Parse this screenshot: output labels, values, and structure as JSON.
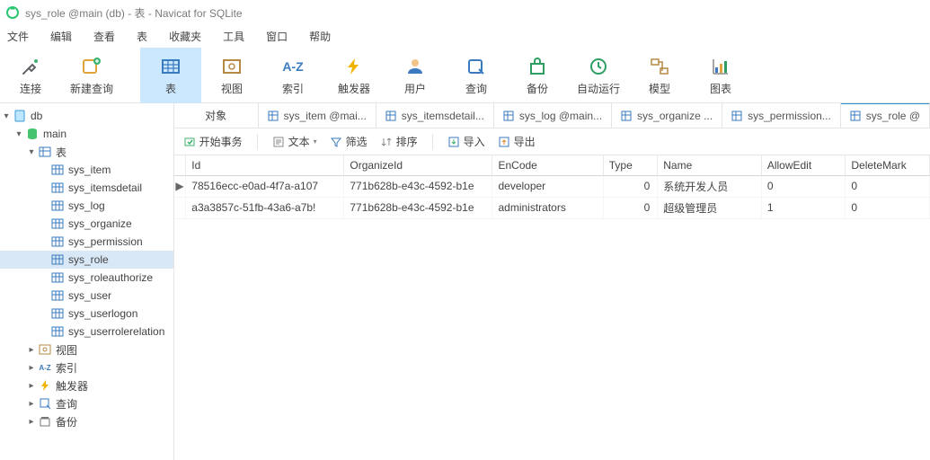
{
  "window": {
    "title": "sys_role @main (db) - 表 - Navicat for SQLite"
  },
  "menu": {
    "file": "文件",
    "edit": "编辑",
    "view": "查看",
    "table": "表",
    "favorites": "收藏夹",
    "tools": "工具",
    "window": "窗口",
    "help": "帮助"
  },
  "toolbar": {
    "connect": "连接",
    "new_query": "新建查询",
    "table": "表",
    "view": "视图",
    "index": "索引",
    "trigger": "触发器",
    "user": "用户",
    "query": "查询",
    "backup": "备份",
    "automation": "自动运行",
    "model": "模型",
    "chart": "图表"
  },
  "tree": {
    "db": "db",
    "main": "main",
    "tables_label": "表",
    "tables": [
      "sys_item",
      "sys_itemsdetail",
      "sys_log",
      "sys_organize",
      "sys_permission",
      "sys_role",
      "sys_roleauthorize",
      "sys_user",
      "sys_userlogon",
      "sys_userrolerelation"
    ],
    "views": "视图",
    "indexes": "索引",
    "triggers": "触发器",
    "queries": "查询",
    "backups": "备份"
  },
  "tabs": {
    "object": "对象",
    "items": [
      "sys_item @mai...",
      "sys_itemsdetail...",
      "sys_log @main...",
      "sys_organize ...",
      "sys_permission...",
      "sys_role @"
    ]
  },
  "actions": {
    "begin_tx": "开始事务",
    "text": "文本",
    "filter": "筛选",
    "sort": "排序",
    "import": "导入",
    "export": "导出"
  },
  "grid": {
    "columns": [
      "Id",
      "OrganizeId",
      "EnCode",
      "Type",
      "Name",
      "AllowEdit",
      "DeleteMark"
    ],
    "rows": [
      {
        "Id": "78516ecc-e0ad-4f7a-a107",
        "OrganizeId": "771b628b-e43c-4592-b1e",
        "EnCode": "developer",
        "Type": 0,
        "Name": "系统开发人员",
        "AllowEdit": 0,
        "DeleteMark": 0
      },
      {
        "Id": "a3a3857c-51fb-43a6-a7b!",
        "OrganizeId": "771b628b-e43c-4592-b1e",
        "EnCode": "administrators",
        "Type": 0,
        "Name": "超级管理员",
        "AllowEdit": 1,
        "DeleteMark": 0
      }
    ]
  },
  "icons": {
    "az": "A-Z"
  }
}
